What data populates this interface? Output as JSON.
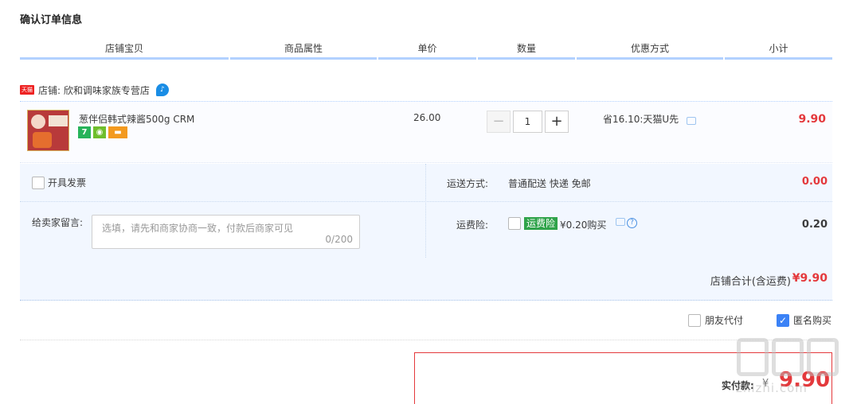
{
  "page_title": "确认订单信息",
  "columns": [
    "店铺宝贝",
    "商品属性",
    "单价",
    "数量",
    "优惠方式",
    "小计"
  ],
  "shop": {
    "badge": "天猫",
    "label": "店铺: 欣和调味家族专营店"
  },
  "item": {
    "name": "葱伴侣韩式辣酱500g CRM",
    "badges": [
      "7",
      "",
      ""
    ],
    "unit_price": "26.00",
    "quantity": "1",
    "qty_minus": "−",
    "qty_plus": "+",
    "discount": "省16.10:天猫U先",
    "subtotal": "9.90"
  },
  "invoice": {
    "label": "开具发票"
  },
  "shipping": {
    "label": "运送方式:",
    "value": "普通配送 快递 免邮",
    "fee": "0.00"
  },
  "message": {
    "label": "给卖家留言:",
    "placeholder": "选填，请先和商家协商一致，付款后商家可见",
    "count": "0/200"
  },
  "insurance": {
    "label": "运费险:",
    "tag": "运费险",
    "price": "¥0.20购买",
    "fee": "0.20"
  },
  "shop_total": {
    "label": "店铺合计(含运费)",
    "value": "¥9.90"
  },
  "extras": {
    "friend_pay": "朋友代付",
    "anonymous": "匿名购买"
  },
  "payment": {
    "label": "实付款:",
    "currency": "¥",
    "value": "9.90"
  },
  "watermark": "zhizhi.com",
  "colors": {
    "accent_red": "#e4393c",
    "header_line": "#b2d1ff",
    "panel_bg": "#f2f7ff",
    "checkbox_on": "#3b82f6"
  }
}
